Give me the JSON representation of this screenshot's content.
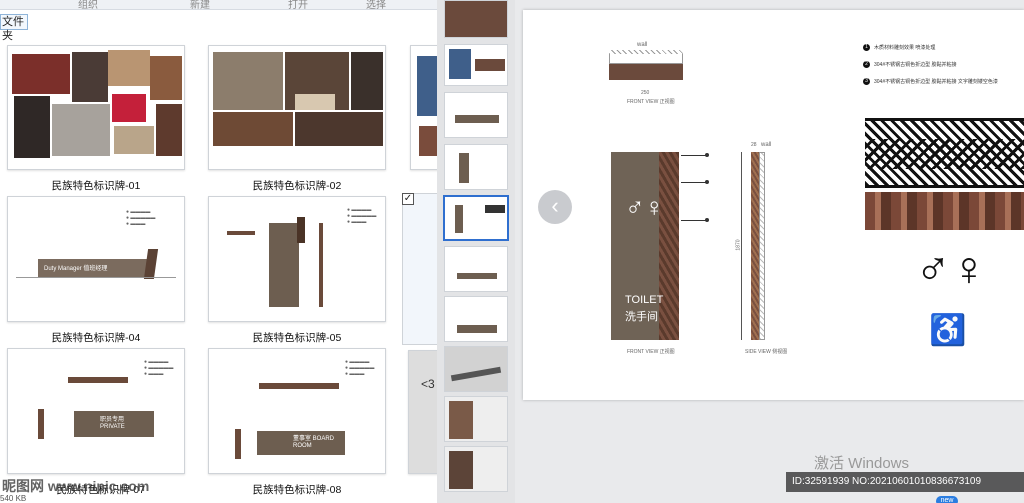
{
  "explorer": {
    "ribbon": [
      "组织",
      "新建",
      "打开",
      "选择"
    ],
    "folder_label": "文件夹",
    "files": [
      {
        "name": "民族特色标识牌-01"
      },
      {
        "name": "民族特色标识牌-02"
      },
      {
        "name": "民族特色标识牌-04",
        "sign_text": "Duty Manager 值班经理"
      },
      {
        "name": "民族特色标识牌-05"
      },
      {
        "name": "民族特色标识牌-07",
        "sign_text": "职员专用 PRIVATE"
      },
      {
        "name": "民族特色标识牌-08",
        "sign_text": "董事室 BOARD ROOM"
      }
    ],
    "partial_label": "<3",
    "status": "540 KB",
    "checkbox_checked": true
  },
  "viewer": {
    "prev_glyph": "‹",
    "page": {
      "wall_label_top": "wall",
      "wall_label_side": "wall",
      "front_view": "FRONT VIEW 正视图",
      "side_view": "SIDE VIEW 侧视图",
      "dim_top": "250",
      "dim_side": "1870",
      "dim_depth": "28",
      "toilet_en": "TOILET",
      "toilet_cn": "洗手间",
      "notes": [
        {
          "num": "1",
          "text": "木质材料雕刻效果 喷漆处理"
        },
        {
          "num": "2",
          "text": "304#不锈钢古铜色折边型 胶黏并粘接"
        },
        {
          "num": "3",
          "text": "304#不锈钢古铜色折边型 胶黏并粘接 文字雕刻镂空色漆"
        }
      ]
    }
  },
  "overlay": {
    "activate": "激活 Windows",
    "id_text": "ID:32591939 NO:20210601010836673109",
    "watermark": "昵图网 www.nipic.com",
    "new_badge": "new"
  }
}
